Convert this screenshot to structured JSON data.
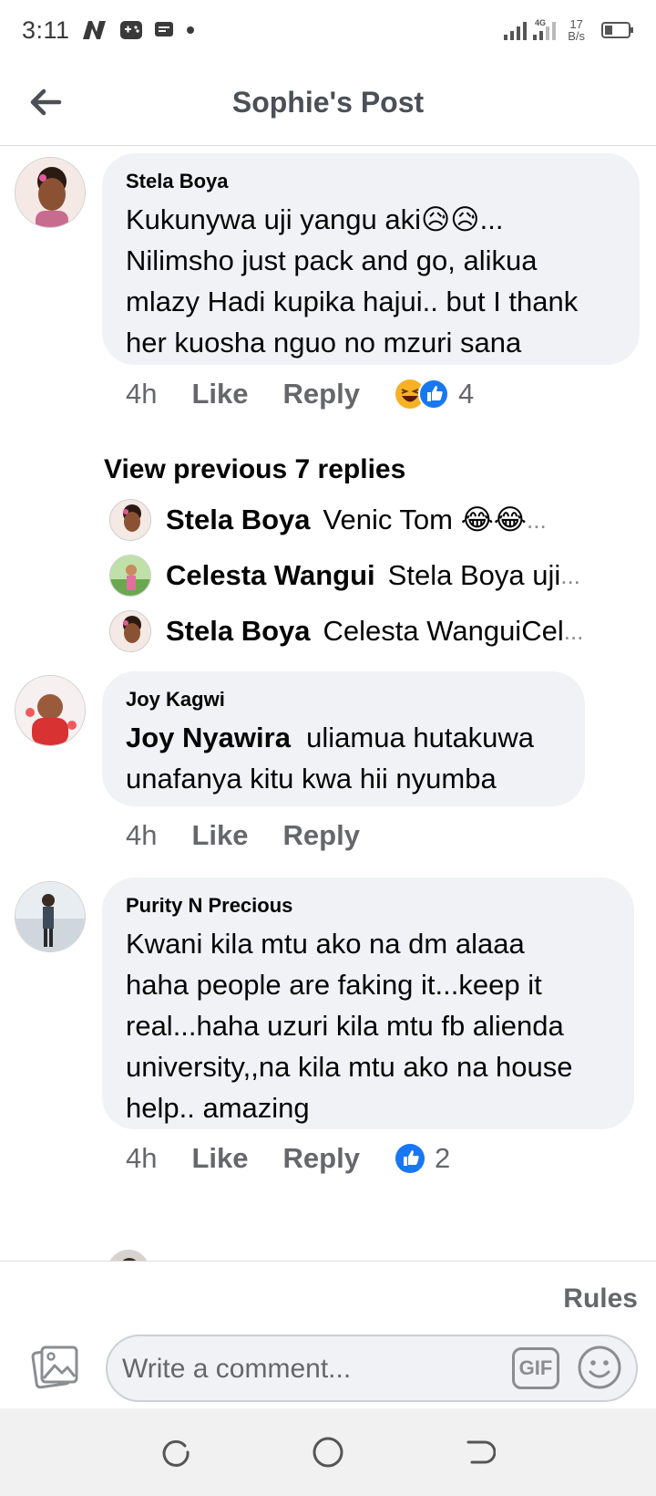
{
  "status_bar": {
    "time": "3:11",
    "network_type": "4G",
    "net_rate_value": "17",
    "net_rate_unit": "B/s",
    "icons": [
      "n-app-icon",
      "game-icon",
      "message-icon",
      "dot-icon",
      "signal-icon",
      "battery-icon"
    ]
  },
  "header": {
    "title": "Sophie's Post",
    "back_icon": "arrow-left-icon"
  },
  "comments": [
    {
      "author": "Stela Boya",
      "lines": [
        "Kukunywa uji yangu aki😥😥...",
        "Nilimsho just pack and go, alikua",
        "mlazy Hadi kupika hajui.. but I thank",
        "her kuosha nguo no mzuri sana"
      ],
      "time": "4h",
      "like": "Like",
      "reply": "Reply",
      "reactions": [
        "haha-icon",
        "like-icon"
      ],
      "reaction_count": "4"
    },
    {
      "author": "Joy Kagwi",
      "mention": "Joy Nyawira",
      "lines": [
        "uliamua hutakuwa",
        "unafanya kitu kwa hii nyumba"
      ],
      "time": "4h",
      "like": "Like",
      "reply": "Reply"
    },
    {
      "author": "Purity N Precious",
      "lines": [
        "Kwani kila mtu ako na dm alaaa",
        "haha people are faking it...keep it",
        "real...haha uzuri kila mtu fb alienda",
        "university,,na kila mtu ako na house",
        "help.. amazing"
      ],
      "time": "4h",
      "like": "Like",
      "reply": "Reply",
      "reactions": [
        "like-icon"
      ],
      "reaction_count": "2"
    }
  ],
  "view_previous": "View previous 7 replies",
  "replies": [
    {
      "name": "Stela Boya",
      "text": "Venic Tom 😂😂",
      "ellipsis": "..."
    },
    {
      "name": "Celesta Wangui",
      "text": "Stela Boya uji",
      "ellipsis": "..."
    },
    {
      "name": "Stela Boya",
      "text": "Celesta WanguiCel",
      "ellipsis": "..."
    }
  ],
  "footer": {
    "rules": "Rules",
    "comment_placeholder": "Write a comment...",
    "gif_label": "GIF"
  },
  "nav": [
    "recents-icon",
    "home-icon",
    "back-icon"
  ],
  "colors": {
    "bubble_bg": "#f0f2f5",
    "like_blue": "#1877f2",
    "meta_gray": "#65676b",
    "nav_bg": "#f1f1f1"
  }
}
